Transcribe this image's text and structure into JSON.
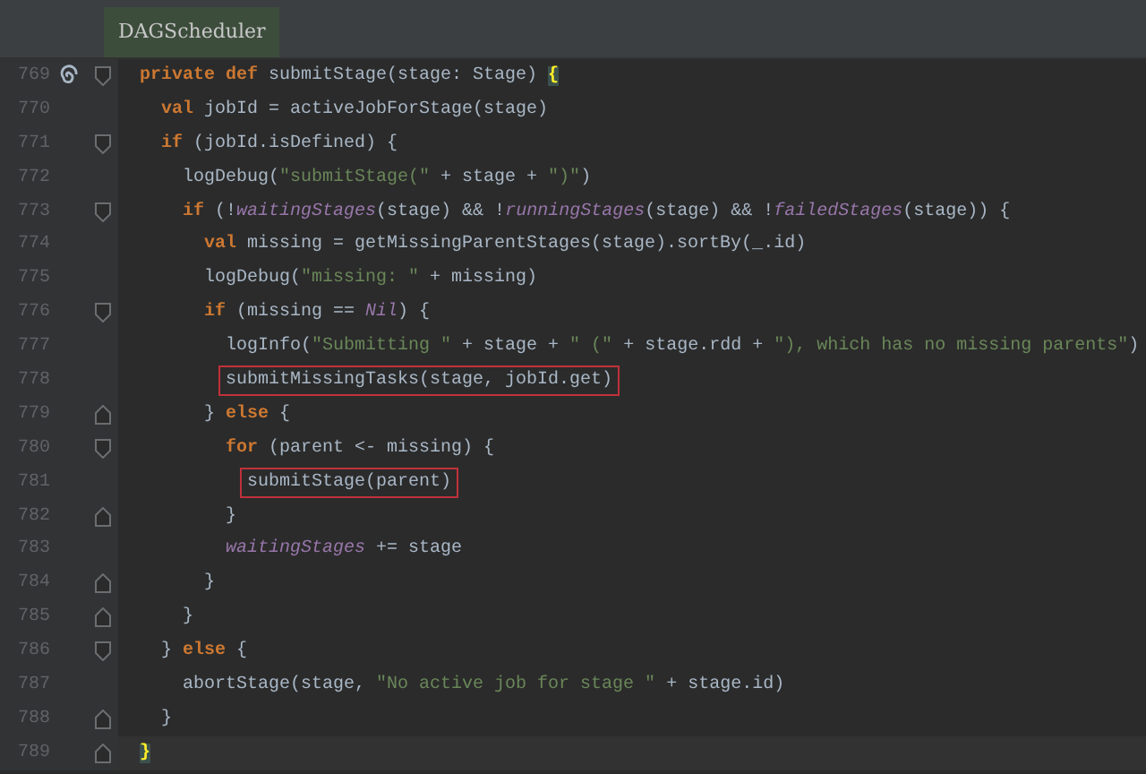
{
  "tab": {
    "label": "DAGScheduler",
    "selected": true
  },
  "lines": [
    {
      "number": "769",
      "marker": true,
      "fold_start": true,
      "fold_end": false,
      "boxed": false,
      "current": false,
      "tokens": [
        {
          "kind": "kw",
          "text": "private def "
        },
        {
          "kind": "plain",
          "text": "submitStage(stage: Stage) "
        },
        {
          "kind": "match",
          "text": "{"
        }
      ],
      "children": [
        {
          "number": "770",
          "marker": false,
          "fold_start": false,
          "fold_end": false,
          "boxed": false,
          "current": false,
          "tokens": [
            {
              "kind": "kw",
              "text": "val "
            },
            {
              "kind": "plain",
              "text": "jobId = activeJobForStage(stage)"
            }
          ]
        },
        {
          "number": "771",
          "marker": false,
          "fold_start": true,
          "fold_end": false,
          "boxed": false,
          "current": false,
          "tokens": [
            {
              "kind": "kw",
              "text": "if "
            },
            {
              "kind": "plain",
              "text": "(jobId.isDefined) {"
            }
          ],
          "children": [
            {
              "number": "772",
              "marker": false,
              "fold_start": false,
              "fold_end": false,
              "boxed": false,
              "current": false,
              "tokens": [
                {
                  "kind": "plain",
                  "text": "logDebug("
                },
                {
                  "kind": "str",
                  "text": "\"submitStage(\""
                },
                {
                  "kind": "plain",
                  "text": " + stage + "
                },
                {
                  "kind": "str",
                  "text": "\")\""
                },
                {
                  "kind": "plain",
                  "text": ")"
                }
              ]
            },
            {
              "number": "773",
              "marker": false,
              "fold_start": true,
              "fold_end": false,
              "boxed": false,
              "current": false,
              "tokens": [
                {
                  "kind": "kw",
                  "text": "if "
                },
                {
                  "kind": "plain",
                  "text": "(!"
                },
                {
                  "kind": "ital",
                  "text": "waitingStages"
                },
                {
                  "kind": "plain",
                  "text": "(stage) && !"
                },
                {
                  "kind": "ital",
                  "text": "runningStages"
                },
                {
                  "kind": "plain",
                  "text": "(stage) && !"
                },
                {
                  "kind": "ital",
                  "text": "failedStages"
                },
                {
                  "kind": "plain",
                  "text": "(stage)) {"
                }
              ],
              "children": [
                {
                  "number": "774",
                  "marker": false,
                  "fold_start": false,
                  "fold_end": false,
                  "boxed": false,
                  "current": false,
                  "tokens": [
                    {
                      "kind": "kw",
                      "text": "val "
                    },
                    {
                      "kind": "plain",
                      "text": "missing = getMissingParentStages(stage).sortBy(_.id)"
                    }
                  ]
                },
                {
                  "number": "775",
                  "marker": false,
                  "fold_start": false,
                  "fold_end": false,
                  "boxed": false,
                  "current": false,
                  "tokens": [
                    {
                      "kind": "plain",
                      "text": "logDebug("
                    },
                    {
                      "kind": "str",
                      "text": "\"missing: \""
                    },
                    {
                      "kind": "plain",
                      "text": " + missing)"
                    }
                  ]
                },
                {
                  "number": "776",
                  "marker": false,
                  "fold_start": true,
                  "fold_end": false,
                  "boxed": false,
                  "current": false,
                  "tokens": [
                    {
                      "kind": "kw",
                      "text": "if "
                    },
                    {
                      "kind": "plain",
                      "text": "(missing == "
                    },
                    {
                      "kind": "ital",
                      "text": "Nil"
                    },
                    {
                      "kind": "plain",
                      "text": ") {"
                    }
                  ],
                  "children": [
                    {
                      "number": "777",
                      "marker": false,
                      "fold_start": false,
                      "fold_end": false,
                      "boxed": false,
                      "current": false,
                      "tokens": [
                        {
                          "kind": "plain",
                          "text": "logInfo("
                        },
                        {
                          "kind": "str",
                          "text": "\"Submitting \""
                        },
                        {
                          "kind": "plain",
                          "text": " + stage + "
                        },
                        {
                          "kind": "str",
                          "text": "\" (\""
                        },
                        {
                          "kind": "plain",
                          "text": " + stage.rdd + "
                        },
                        {
                          "kind": "str",
                          "text": "\"), which has no missing parents\""
                        },
                        {
                          "kind": "plain",
                          "text": ")"
                        }
                      ]
                    },
                    {
                      "number": "778",
                      "marker": false,
                      "fold_start": false,
                      "fold_end": false,
                      "boxed": true,
                      "current": false,
                      "tokens": [
                        {
                          "kind": "plain",
                          "text": "submitMissingTasks(stage, jobId.get)"
                        }
                      ]
                    }
                  ]
                },
                {
                  "number": "779",
                  "marker": false,
                  "fold_start": false,
                  "fold_end": true,
                  "boxed": false,
                  "current": false,
                  "tokens": [
                    {
                      "kind": "plain",
                      "text": "} "
                    },
                    {
                      "kind": "kw",
                      "text": "else "
                    },
                    {
                      "kind": "plain",
                      "text": "{"
                    }
                  ],
                  "children": [
                    {
                      "number": "780",
                      "marker": false,
                      "fold_start": true,
                      "fold_end": false,
                      "boxed": false,
                      "current": false,
                      "tokens": [
                        {
                          "kind": "kw",
                          "text": "for "
                        },
                        {
                          "kind": "plain",
                          "text": "(parent <- missing) {"
                        }
                      ],
                      "children": [
                        {
                          "number": "781",
                          "marker": false,
                          "fold_start": false,
                          "fold_end": false,
                          "boxed": true,
                          "current": false,
                          "tokens": [
                            {
                              "kind": "plain",
                              "text": "submitStage(parent)"
                            }
                          ]
                        }
                      ]
                    },
                    {
                      "number": "782",
                      "marker": false,
                      "fold_start": false,
                      "fold_end": true,
                      "boxed": false,
                      "current": false,
                      "tokens": [
                        {
                          "kind": "plain",
                          "text": "}"
                        }
                      ]
                    },
                    {
                      "number": "783",
                      "marker": false,
                      "fold_start": false,
                      "fold_end": false,
                      "boxed": false,
                      "current": false,
                      "tokens": [
                        {
                          "kind": "ital",
                          "text": "waitingStages"
                        },
                        {
                          "kind": "plain",
                          "text": " += stage"
                        }
                      ]
                    }
                  ]
                },
                {
                  "number": "784",
                  "marker": false,
                  "fold_start": false,
                  "fold_end": true,
                  "boxed": false,
                  "current": false,
                  "tokens": [
                    {
                      "kind": "plain",
                      "text": "}"
                    }
                  ]
                }
              ]
            },
            {
              "number": "785",
              "marker": false,
              "fold_start": false,
              "fold_end": true,
              "boxed": false,
              "current": false,
              "tokens": [
                {
                  "kind": "plain",
                  "text": "}"
                }
              ]
            }
          ]
        },
        {
          "number": "786",
          "marker": false,
          "fold_start": true,
          "fold_end": false,
          "boxed": false,
          "current": false,
          "tokens": [
            {
              "kind": "plain",
              "text": "} "
            },
            {
              "kind": "kw",
              "text": "else "
            },
            {
              "kind": "plain",
              "text": "{"
            }
          ],
          "children": [
            {
              "number": "787",
              "marker": false,
              "fold_start": false,
              "fold_end": false,
              "boxed": false,
              "current": false,
              "tokens": [
                {
                  "kind": "plain",
                  "text": "abortStage(stage, "
                },
                {
                  "kind": "str",
                  "text": "\"No active job for stage \""
                },
                {
                  "kind": "plain",
                  "text": " + stage.id)"
                }
              ]
            }
          ]
        },
        {
          "number": "788",
          "marker": false,
          "fold_start": false,
          "fold_end": true,
          "boxed": false,
          "current": false,
          "tokens": [
            {
              "kind": "plain",
              "text": "}"
            }
          ]
        }
      ]
    },
    {
      "number": "789",
      "marker": false,
      "fold_start": false,
      "fold_end": true,
      "boxed": false,
      "current": true,
      "tokens": [
        {
          "kind": "match",
          "text": "}"
        }
      ]
    }
  ]
}
